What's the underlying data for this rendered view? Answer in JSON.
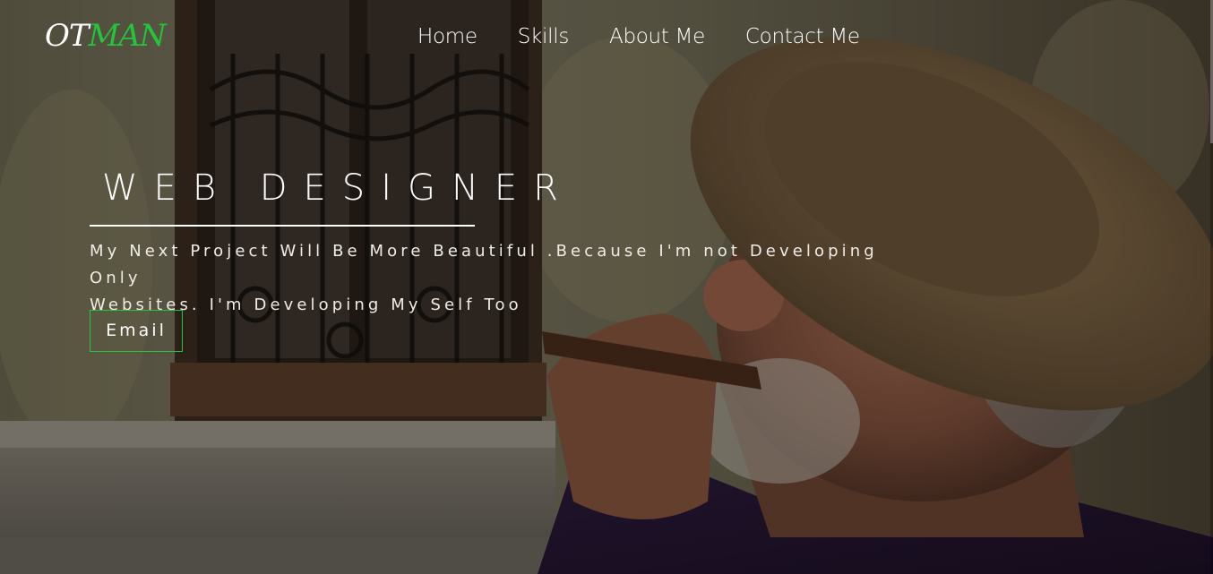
{
  "brand": {
    "logo_part_1": "OT",
    "logo_part_2": "MAN",
    "accent_color": "#22c63a"
  },
  "nav": {
    "items": [
      {
        "label": "Home"
      },
      {
        "label": "Skills"
      },
      {
        "label": "About Me"
      },
      {
        "label": "Contact Me"
      }
    ]
  },
  "hero": {
    "headline": "WEB DESIGNER",
    "tagline_line_1": "My Next Project Will Be More Beautiful .Because I'm not Developing Only",
    "tagline_line_2": "Websites. I'm Developing My Self Too",
    "cta_label": "Email",
    "background": "photo of elderly man in straw hat smoking a cigar beside a window"
  }
}
